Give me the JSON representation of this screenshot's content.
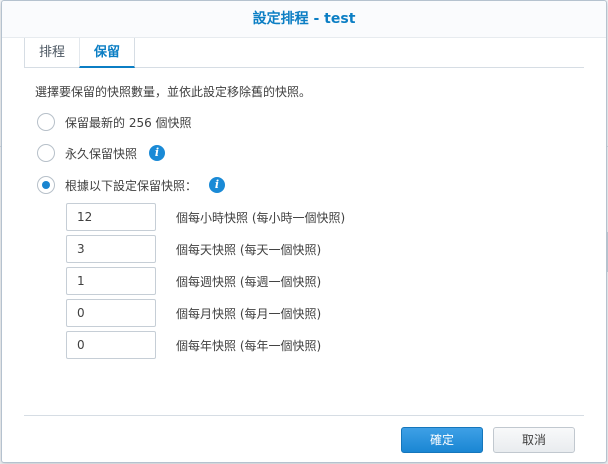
{
  "dialog": {
    "title": "設定排程 - test"
  },
  "tabs": [
    {
      "label": "排程",
      "active": false
    },
    {
      "label": "保留",
      "active": true
    }
  ],
  "description": "選擇要保留的快照數量，並依此設定移除舊的快照。",
  "options": [
    {
      "label": "保留最新的 256 個快照",
      "selected": false,
      "info": false
    },
    {
      "label": "永久保留快照",
      "selected": false,
      "info": true
    },
    {
      "label": "根據以下設定保留快照：",
      "selected": true,
      "info": true
    }
  ],
  "retention": [
    {
      "value": "12",
      "label": "個每小時快照 (每小時一個快照)"
    },
    {
      "value": "3",
      "label": "個每天快照 (每天一個快照)"
    },
    {
      "value": "1",
      "label": "個每週快照 (每週一個快照)"
    },
    {
      "value": "0",
      "label": "個每月快照 (每月一個快照)"
    },
    {
      "value": "0",
      "label": "個每年快照 (每年一個快照)"
    }
  ],
  "buttons": {
    "ok": "確定",
    "cancel": "取消"
  },
  "colors": {
    "accent": "#0b7ec4",
    "primary_button": "#1a86d3"
  }
}
